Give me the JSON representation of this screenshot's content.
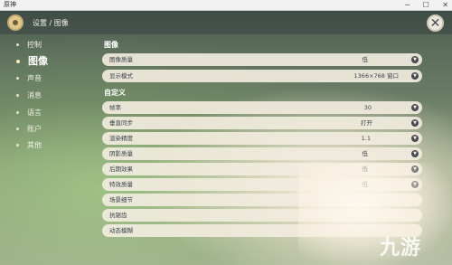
{
  "window": {
    "title": "原神",
    "minimize": "─",
    "maximize": "☐",
    "close": "✕"
  },
  "header": {
    "breadcrumb": "设置 / 图像",
    "close_glyph": "✕"
  },
  "sidebar": {
    "items": [
      {
        "label": "控制",
        "active": false
      },
      {
        "label": "图像",
        "active": true
      },
      {
        "label": "声音",
        "active": false
      },
      {
        "label": "消息",
        "active": false
      },
      {
        "label": "语言",
        "active": false
      },
      {
        "label": "账户",
        "active": false
      },
      {
        "label": "其他",
        "active": false
      }
    ]
  },
  "sections": {
    "image": "图像",
    "custom": "自定义"
  },
  "rows": [
    {
      "label": "图像质量",
      "value": "低"
    },
    {
      "label": "显示模式",
      "value": "1366×768 窗口"
    },
    {
      "label": "帧率",
      "value": "30"
    },
    {
      "label": "垂直同步",
      "value": "打开"
    },
    {
      "label": "渲染精度",
      "value": "1.1"
    },
    {
      "label": "阴影质量",
      "value": "低"
    },
    {
      "label": "后期效果",
      "value": "低"
    },
    {
      "label": "特效质量",
      "value": "低"
    },
    {
      "label": "场景细节",
      "value": ""
    },
    {
      "label": "抗锯齿",
      "value": ""
    },
    {
      "label": "动态模糊",
      "value": ""
    }
  ],
  "watermark": "九游"
}
